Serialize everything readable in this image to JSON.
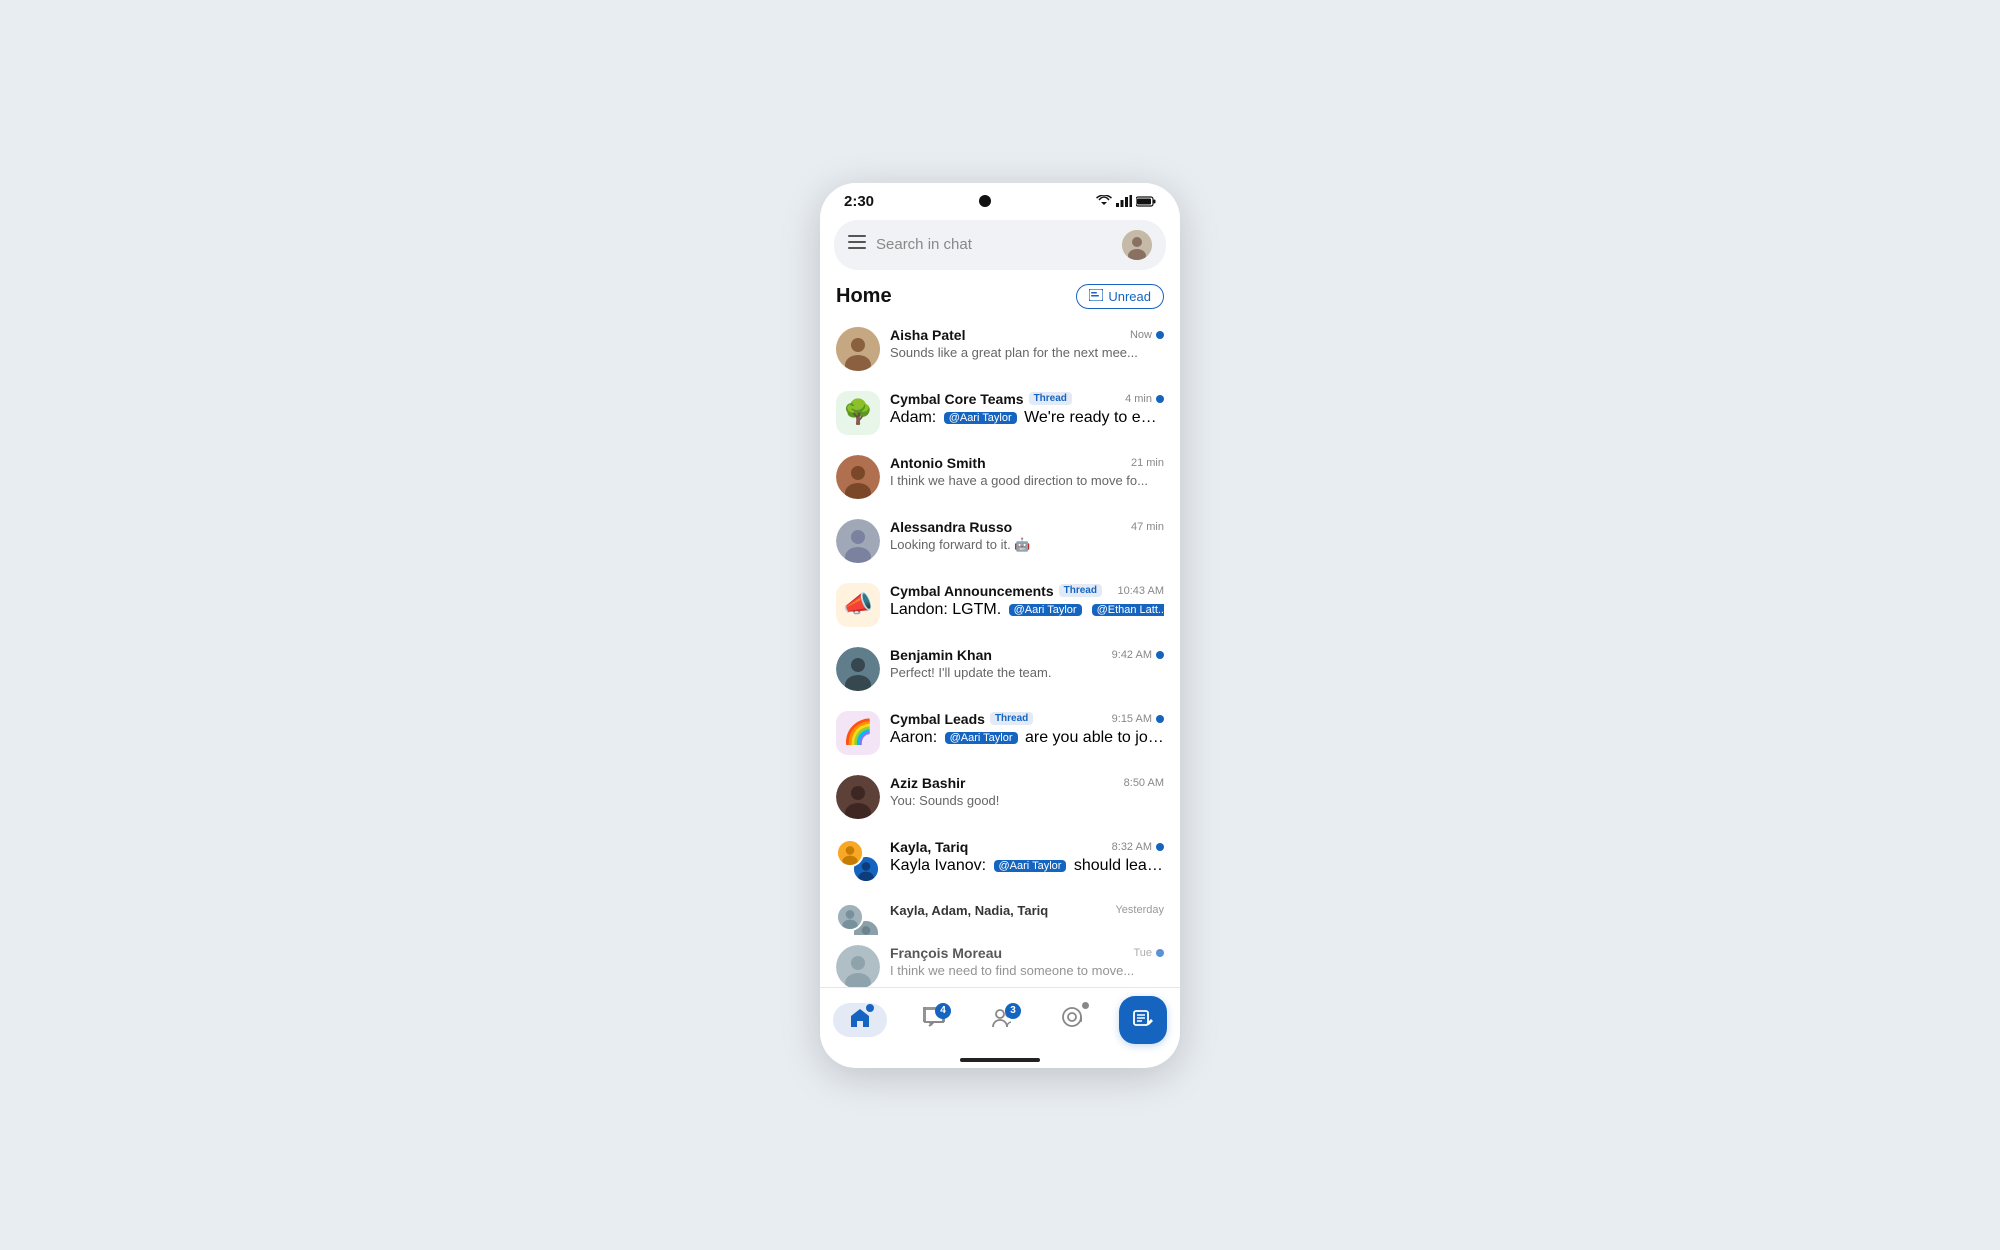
{
  "status_bar": {
    "time": "2:30",
    "battery_icon": "🔋",
    "wifi_icon": "▲",
    "signal_icon": "📶"
  },
  "search": {
    "placeholder": "Search in chat"
  },
  "home": {
    "title": "Home",
    "unread_label": "Unread"
  },
  "chats": [
    {
      "id": "aisha-patel",
      "name": "Aisha Patel",
      "time": "Now",
      "preview": "Sounds like a great plan for the next mee...",
      "unread": true,
      "has_mention": false,
      "mention_tag": "",
      "preview_suffix": "",
      "avatar_type": "person",
      "avatar_color": "#c5a882",
      "avatar_label": "AP",
      "is_thread": false
    },
    {
      "id": "cymbal-core",
      "name": "Cymbal Core Teams",
      "time": "4 min",
      "preview": "Adam: ",
      "mention_tag": "@Aari Taylor",
      "preview_suffix": " We're ready to expl...",
      "unread": true,
      "avatar_type": "emoji",
      "avatar_emoji": "🌳",
      "avatar_color": "#e8f5e9",
      "is_thread": true
    },
    {
      "id": "antonio-smith",
      "name": "Antonio Smith",
      "time": "21 min",
      "preview": "I think we have a good direction to move fo...",
      "unread": false,
      "has_mention": false,
      "mention_tag": "",
      "preview_suffix": "",
      "avatar_type": "person",
      "avatar_color": "#b07050",
      "avatar_label": "AS",
      "is_thread": false
    },
    {
      "id": "alessandra-russo",
      "name": "Alessandra Russo",
      "time": "47 min",
      "preview": "Looking forward to it. 🤖",
      "unread": false,
      "has_mention": false,
      "mention_tag": "",
      "preview_suffix": "",
      "avatar_type": "person",
      "avatar_color": "#a0a8b8",
      "avatar_label": "AR",
      "is_thread": false
    },
    {
      "id": "cymbal-announcements",
      "name": "Cymbal Announcements",
      "time": "10:43 AM",
      "preview": "Landon: LGTM. ",
      "mention_tag": "@Aari Taylor",
      "mention_tag2": "@Ethan Latt...",
      "preview_suffix": "",
      "unread": false,
      "avatar_type": "emoji",
      "avatar_emoji": "📣",
      "avatar_color": "#fff3e0",
      "is_thread": true
    },
    {
      "id": "benjamin-khan",
      "name": "Benjamin Khan",
      "time": "9:42 AM",
      "preview": "Perfect! I'll update the team.",
      "unread": true,
      "has_mention": false,
      "mention_tag": "",
      "preview_suffix": "",
      "avatar_type": "person",
      "avatar_color": "#607d8b",
      "avatar_label": "BK",
      "is_thread": false
    },
    {
      "id": "cymbal-leads",
      "name": "Cymbal Leads",
      "time": "9:15 AM",
      "preview": "Aaron: ",
      "mention_tag": "@Aari Taylor",
      "preview_suffix": " are you able to join...",
      "unread": true,
      "avatar_type": "emoji",
      "avatar_emoji": "🌈",
      "avatar_color": "#f3e5f5",
      "is_thread": true
    },
    {
      "id": "aziz-bashir",
      "name": "Aziz Bashir",
      "time": "8:50 AM",
      "preview": "You: Sounds good!",
      "unread": false,
      "has_mention": false,
      "mention_tag": "",
      "preview_suffix": "",
      "avatar_type": "person",
      "avatar_color": "#5d4037",
      "avatar_label": "AB",
      "is_thread": false
    },
    {
      "id": "kayla-tariq",
      "name": "Kayla, Tariq",
      "time": "8:32 AM",
      "preview": "Kayla Ivanov: ",
      "mention_tag": "@Aari Taylor",
      "preview_suffix": " should lead...",
      "unread": true,
      "avatar_type": "multi",
      "avatar_color": "#f9a825",
      "avatar_color2": "#1565c0",
      "avatar_label": "K",
      "avatar_label2": "T",
      "is_thread": false
    },
    {
      "id": "francois-moreau",
      "name": "François Moreau",
      "time": "Tue",
      "preview": "I think we need to find someone to move...",
      "unread": true,
      "has_mention": false,
      "mention_tag": "",
      "preview_suffix": "",
      "avatar_type": "person",
      "avatar_color": "#90a4ae",
      "avatar_label": "FM",
      "is_thread": false,
      "partial": true
    }
  ],
  "bottom_nav": {
    "items": [
      {
        "id": "home",
        "label": "Home",
        "icon": "⌂",
        "active": true,
        "badge": null
      },
      {
        "id": "chat",
        "label": "Chat",
        "icon": "💬",
        "active": false,
        "badge": "4"
      },
      {
        "id": "people",
        "label": "People",
        "icon": "👥",
        "active": false,
        "badge": "3"
      },
      {
        "id": "mention",
        "label": "Mention",
        "icon": "@",
        "active": false,
        "badge": "·"
      }
    ],
    "fab_icon": "✏️"
  }
}
